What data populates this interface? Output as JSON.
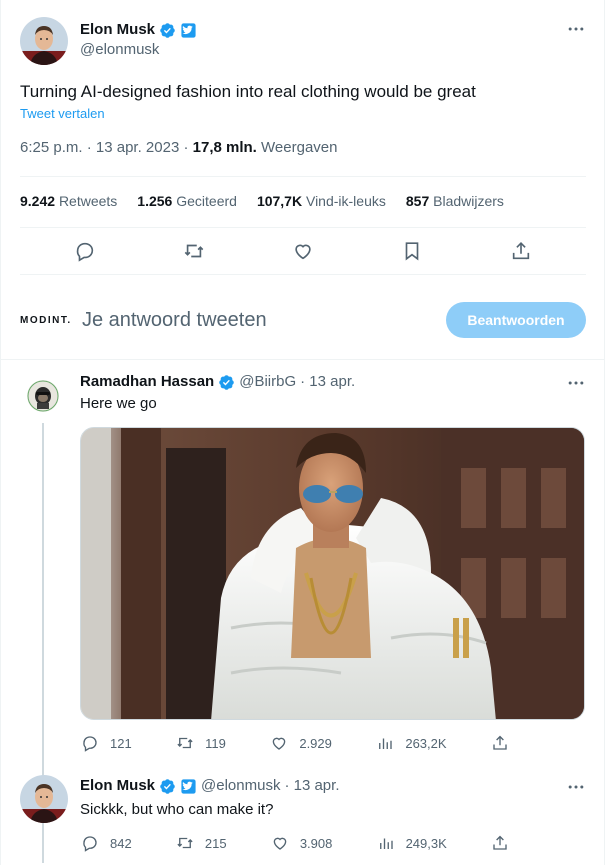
{
  "main_tweet": {
    "author_name": "Elon Musk",
    "author_handle": "@elonmusk",
    "text": "Turning AI-designed fashion into real clothing would be great",
    "translate_label": "Tweet vertalen",
    "time": "6:25 p.m.",
    "date": "13 apr. 2023",
    "views_count": "17,8 mln.",
    "views_label": "Weergaven",
    "stats": [
      {
        "count": "9.242",
        "label": "Retweets"
      },
      {
        "count": "1.256",
        "label": "Geciteerd"
      },
      {
        "count": "107,7K",
        "label": "Vind-ik-leuks"
      },
      {
        "count": "857",
        "label": "Bladwijzers"
      }
    ],
    "actions": [
      "reply-icon",
      "retweet-icon",
      "like-icon",
      "bookmark-icon",
      "share-icon"
    ]
  },
  "reply_box": {
    "logo_text": "MODINT.",
    "placeholder": "Je antwoord tweeten",
    "button_label": "Beantwoorden"
  },
  "reply1": {
    "author_name": "Ramadhan Hassan",
    "author_handle": "@BiirbG",
    "date": "· 13 apr.",
    "text": "Here we go",
    "replies": "121",
    "retweets": "119",
    "likes": "2.929",
    "views": "263,2K"
  },
  "reply2": {
    "author_name": "Elon Musk",
    "author_handle": "@elonmusk",
    "date": "· 13 apr.",
    "text": "Sickkk, but who can make it?",
    "replies": "842",
    "retweets": "215",
    "likes": "3.908",
    "views": "249,3K"
  },
  "colors": {
    "accent": "#1d9bf0",
    "button_disabled": "#8ecdf8",
    "muted_text": "#536471",
    "divider": "#eff3f4",
    "thread_line": "#cfd9de"
  }
}
